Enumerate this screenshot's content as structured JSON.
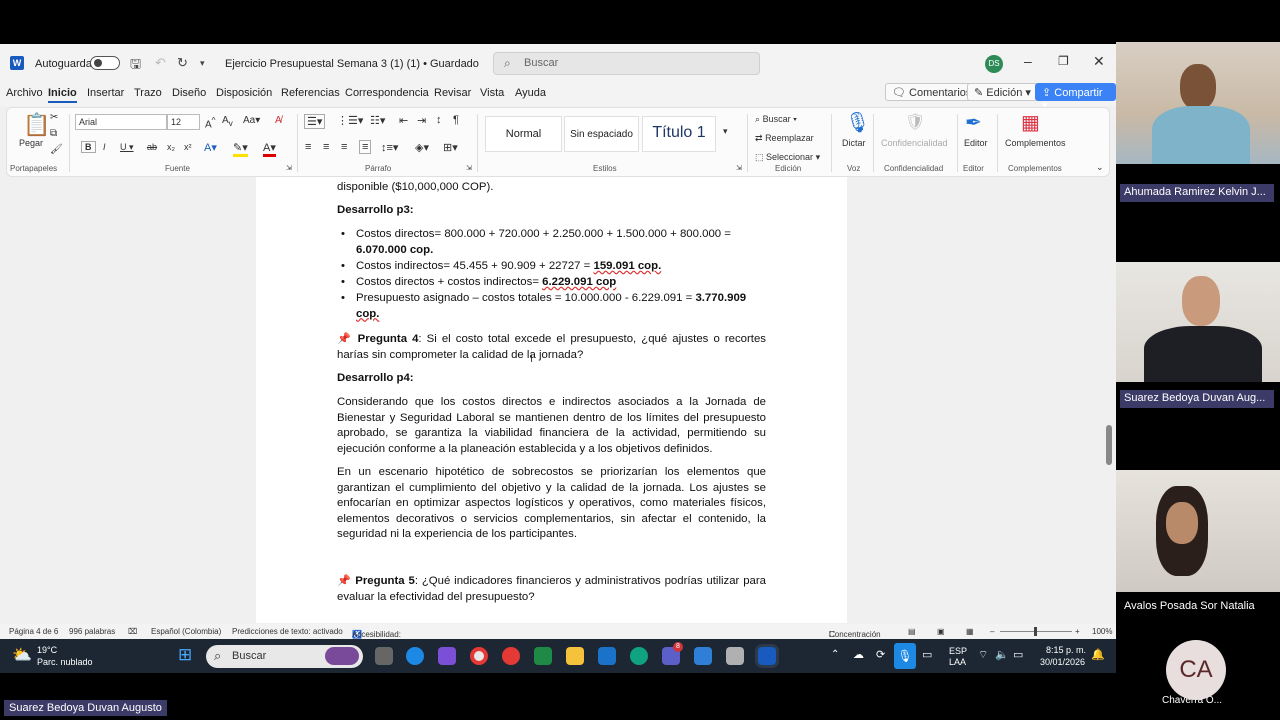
{
  "titlebar": {
    "autosave_label": "Autoguardado",
    "doc_title": "Ejercicio Presupuestal Semana 3 (1) (1) • Guardado",
    "search_placeholder": "Buscar",
    "user_initials": "DS"
  },
  "menu": {
    "items": [
      "Archivo",
      "Inicio",
      "Insertar",
      "Trazo",
      "Diseño",
      "Disposición",
      "Referencias",
      "Correspondencia",
      "Revisar",
      "Vista",
      "Ayuda"
    ],
    "comments": "Comentarios",
    "editing": "Edición",
    "share": "Compartir"
  },
  "ribbon": {
    "paste": "Pegar",
    "font_name": "Arial",
    "font_size": "12",
    "styles": [
      "Normal",
      "Sin espaciado",
      "Título 1"
    ],
    "find": "Buscar",
    "replace": "Reemplazar",
    "select": "Seleccionar",
    "dictate": "Dictar",
    "confidentiality": "Confidencialidad",
    "editor": "Editor",
    "addins": "Complementos",
    "groups": [
      "Portapapeles",
      "Fuente",
      "Párrafo",
      "Estilos",
      "Edición",
      "Voz",
      "Confidencialidad",
      "Editor",
      "Complementos"
    ]
  },
  "document": {
    "top_partial": "disponible ($10,000,000 COP).",
    "h3": "Desarrollo p3:",
    "b1a": "Costos directos= 800.000 + 720.000 + 2.250.000 + 1.500.000 + 800.000 =",
    "b1b": "6.070.000 cop.",
    "b2a": "Costos indirectos= 45.455 + 90.909 + 22727 = ",
    "b2b": "159.091 cop.",
    "b3a": "Costos directos + costos indirectos= ",
    "b3b": "6.229.091 cop",
    "b4a": "Presupuesto asignado – costos totales = 10.000.000 - 6.229.091 = ",
    "b4b": "3.770.909",
    "b4c": "cop.",
    "q4_label": "Pregunta 4",
    "q4_text": ": Si el costo total excede el presupuesto, ¿qué ajustes o recortes harías sin comprometer la calidad de la jornada?",
    "h4": "Desarrollo p4:",
    "p1": "Considerando que los costos directos e indirectos asociados a la Jornada de Bienestar y Seguridad Laboral se mantienen dentro de los límites del presupuesto aprobado, se garantiza la viabilidad financiera de la actividad, permitiendo su ejecución conforme a la planeación establecida y a los objetivos definidos.",
    "p2": "En un escenario hipotético de sobrecostos se priorizarían los elementos que garantizan el cumplimiento del objetivo y la calidad de la jornada. Los ajustes se enfocarían en optimizar aspectos logísticos y operativos, como materiales físicos, elementos decorativos o servicios complementarios, sin afectar el contenido, la seguridad ni la experiencia de los participantes.",
    "q5_label": "Pregunta 5",
    "q5_text": ": ¿Qué indicadores financieros y administrativos podrías utilizar para evaluar la efectividad del presupuesto?"
  },
  "status": {
    "page": "Página 4 de 6",
    "words": "996 palabras",
    "language": "Español (Colombia)",
    "predictions": "Predicciones de texto: activado",
    "accessibility": "Accesibilidad: todo correcto",
    "focus": "Concentración",
    "zoom": "100%"
  },
  "taskbar": {
    "temp": "19°C",
    "weather": "Parc. nublado",
    "search": "Buscar",
    "lang1": "ESP",
    "lang2": "LAA",
    "time": "8:15 p. m.",
    "date": "30/01/2026",
    "badge": "8"
  },
  "participants": {
    "p1": "Ahumada Ramirez Kelvin J...",
    "p2": "Suarez Bedoya Duvan Aug...",
    "p3": "Avalos Posada Sor Natalia",
    "p4_initials": "CA",
    "p4_name": "Chaverra O...",
    "presenter": "Suarez Bedoya Duvan Augusto"
  }
}
